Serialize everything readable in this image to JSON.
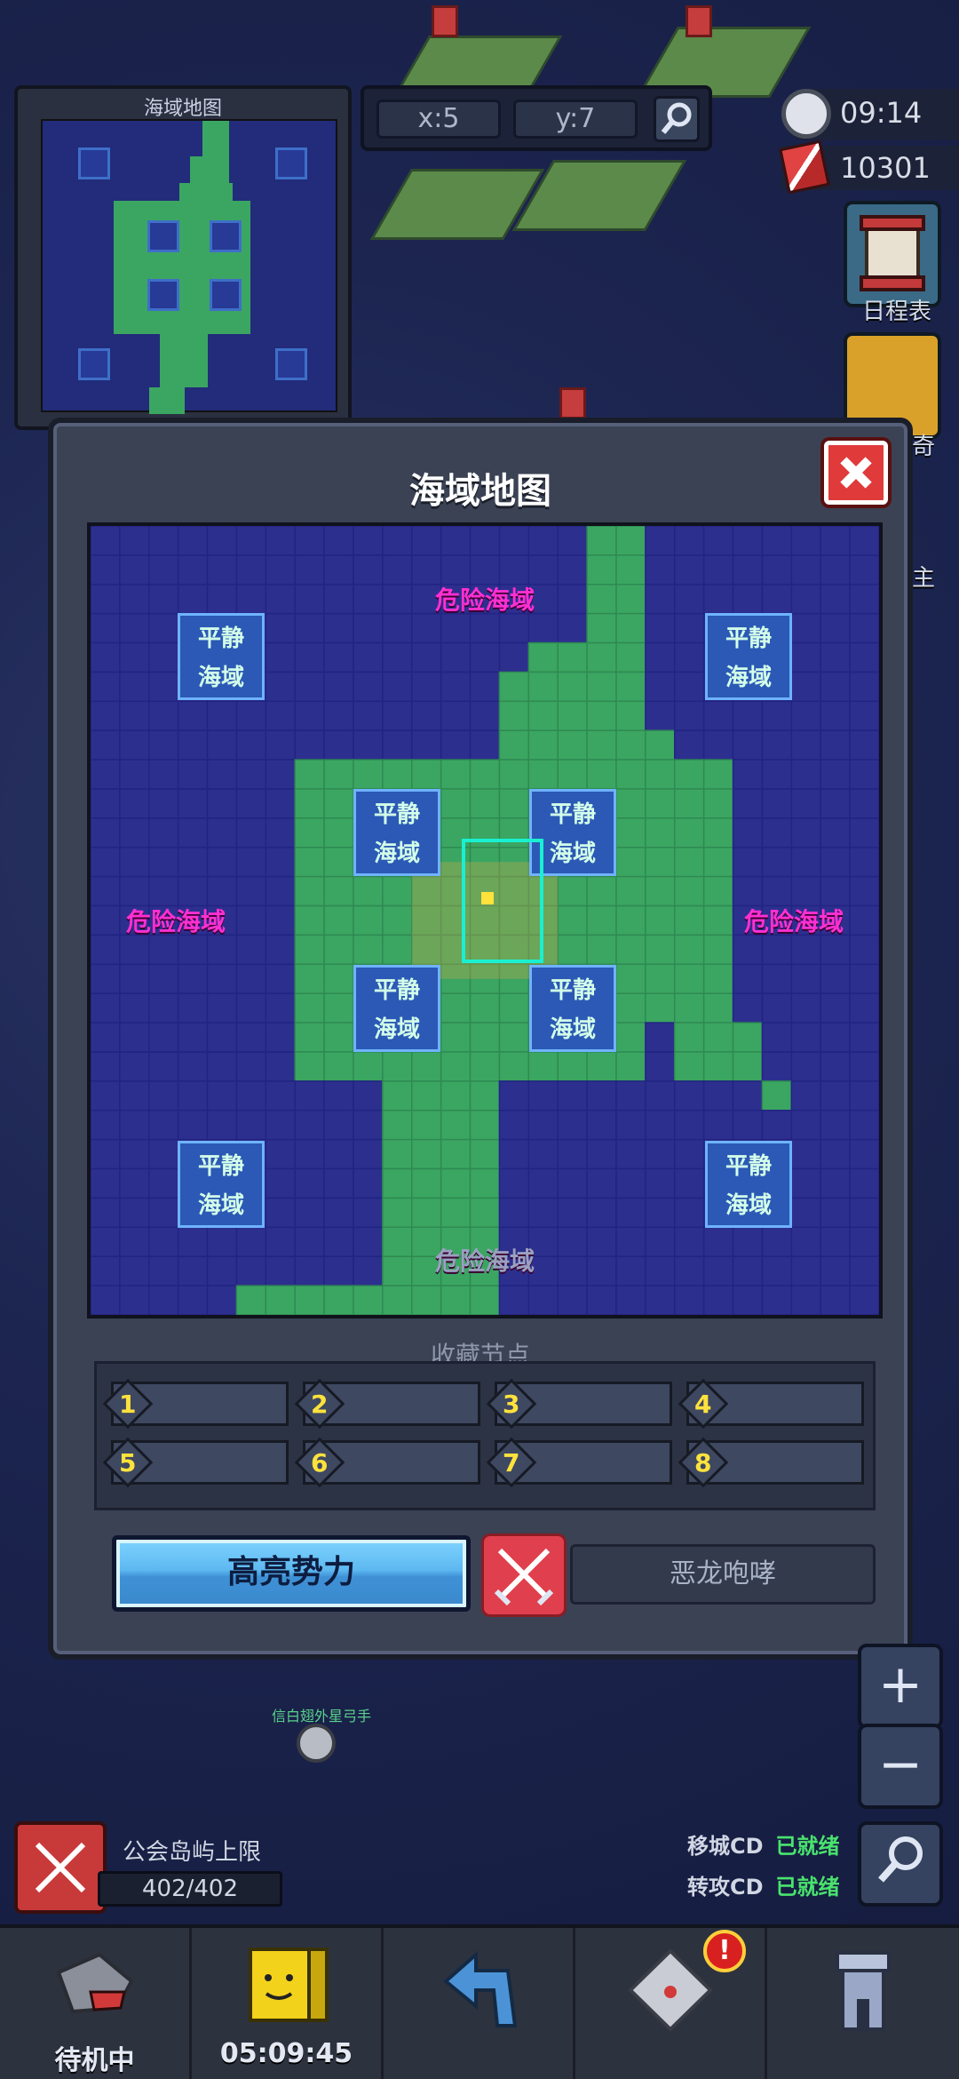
{
  "minimap": {
    "title": "海域地图"
  },
  "coords": {
    "x": "x:5",
    "y": "y:7"
  },
  "clock": {
    "time": "09:14"
  },
  "currency": {
    "value": "10301"
  },
  "side": {
    "schedule_label": "日程表",
    "partial_label_1": "奇",
    "partial_label_2": "主"
  },
  "dialog": {
    "title": "海域地图",
    "calm_label_line1": "平静",
    "calm_label_line2": "海域",
    "danger_top": "危险海域",
    "danger_left": "危险海域",
    "danger_right": "危险海域",
    "danger_bottom": "危险海域",
    "favorites_title": "收藏节点",
    "slots": [
      "1",
      "2",
      "3",
      "4",
      "5",
      "6",
      "7",
      "8"
    ],
    "highlight_button": "高亮势力",
    "roar_button": "恶龙咆哮"
  },
  "map_player_label": "信白翅外星弓手",
  "guild": {
    "label": "公会岛屿上限",
    "value": "402/402"
  },
  "cooldowns": [
    {
      "label": "移城CD",
      "status": "已就绪"
    },
    {
      "label": "转攻CD",
      "status": "已就绪"
    }
  ],
  "tabs": [
    {
      "label": "待机中",
      "icon": "shark-icon"
    },
    {
      "label": "05:09:45",
      "icon": "box-face-icon"
    },
    {
      "label": "",
      "icon": "back-arrow-icon"
    },
    {
      "label": "",
      "icon": "mail-icon"
    },
    {
      "label": "",
      "icon": "tower-icon"
    }
  ],
  "colors": {
    "deep_sea": "#2d2f8e",
    "land": "#3ba662",
    "calm": "#2b59b5",
    "danger_text": "#ff2fd2",
    "accent_blue": "#5db8f0"
  }
}
